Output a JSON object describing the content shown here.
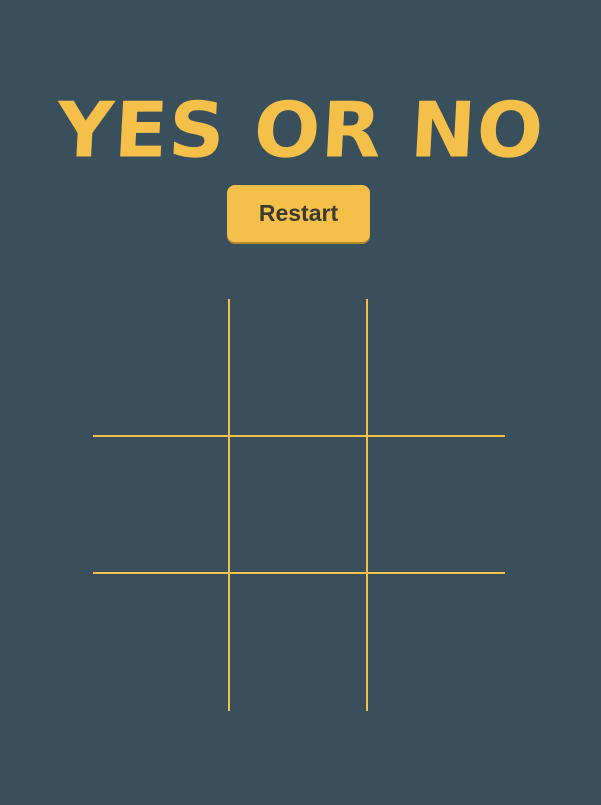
{
  "title": "YES OR NO",
  "restart_label": "Restart",
  "board": {
    "cells": [
      "",
      "",
      "",
      "",
      "",
      "",
      "",
      "",
      ""
    ]
  },
  "colors": {
    "background": "#3a4f5c",
    "accent": "#f5c04a",
    "button_text": "#3a3a2e"
  }
}
